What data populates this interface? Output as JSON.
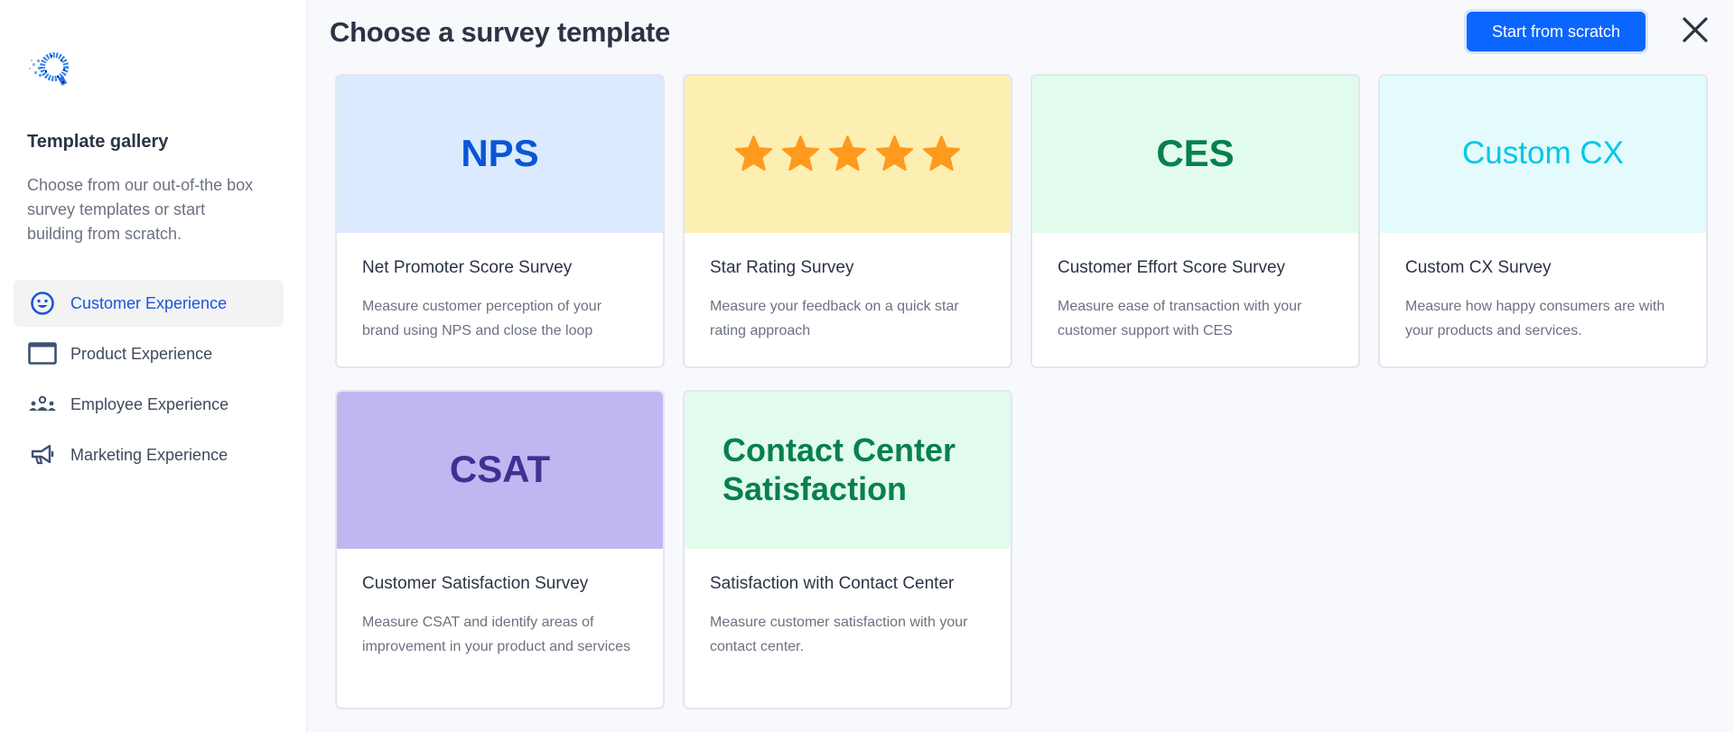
{
  "sidebar": {
    "logo": "dotted-q-logo",
    "title": "Template gallery",
    "description": "Choose from our out-of-the box survey templates or start building from scratch.",
    "items": [
      {
        "label": "Customer Experience",
        "icon": "smiley-icon",
        "active": true
      },
      {
        "label": "Product Experience",
        "icon": "window-icon",
        "active": false
      },
      {
        "label": "Employee Experience",
        "icon": "people-group-icon",
        "active": false
      },
      {
        "label": "Marketing Experience",
        "icon": "megaphone-icon",
        "active": false
      }
    ]
  },
  "header": {
    "title": "Choose a survey template",
    "start_button": "Start from scratch",
    "close_icon": "close-icon"
  },
  "colors": {
    "accent": "#0b66ff",
    "active_nav": "#1a56db"
  },
  "templates": [
    {
      "hero": "NPS",
      "hero_bg": "#dbeafe",
      "hero_color": "#0a55d6",
      "title": "Net Promoter Score Survey",
      "description": "Measure customer perception of your brand using NPS and close the loop"
    },
    {
      "hero": "",
      "hero_stars": 5,
      "hero_bg": "#fdefb2",
      "hero_color": "#ff9a1f",
      "title": "Star Rating Survey",
      "description": "Measure your feedback on a quick star rating approach"
    },
    {
      "hero": "CES",
      "hero_bg": "#e1fcec",
      "hero_color": "#087f4f",
      "title": "Customer Effort Score Survey",
      "description": "Measure ease of transaction with your customer support with CES"
    },
    {
      "hero": "Custom CX",
      "hero_bg": "#e3fbfd",
      "hero_color": "#07c6e4",
      "title": "Custom CX Survey",
      "description": "Measure how happy consumers are with your products and services."
    },
    {
      "hero": "CSAT",
      "hero_bg": "#c1b6f1",
      "hero_color": "#3e3192",
      "title": "Customer Satisfaction Survey",
      "description": "Measure CSAT and identify areas of improvement in your product and services"
    },
    {
      "hero": "Contact Center Satisfaction",
      "hero_bg": "#e1fcec",
      "hero_color": "#087f4f",
      "title": "Satisfaction with Contact Center",
      "description": "Measure customer satisfaction with your contact center."
    }
  ]
}
